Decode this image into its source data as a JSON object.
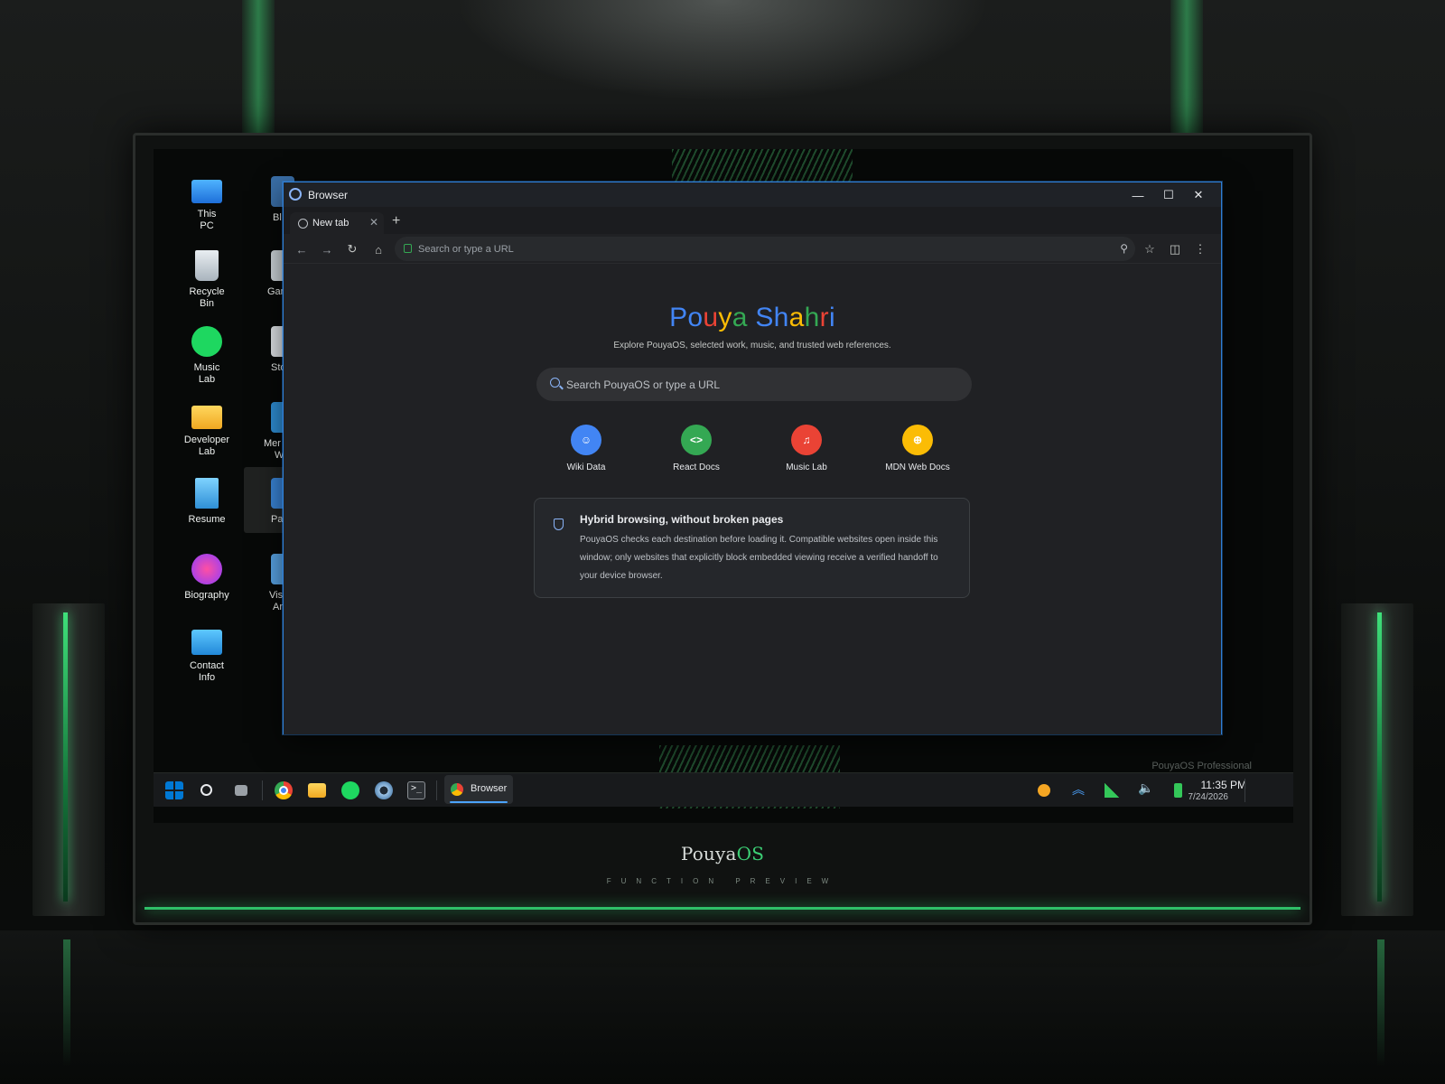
{
  "desktop": {
    "icons": [
      {
        "label_line1": "This",
        "label_line2": "PC"
      },
      {
        "label_line1": "Recycle",
        "label_line2": "Bin"
      },
      {
        "label_line1": "Music",
        "label_line2": "Lab"
      },
      {
        "label_line1": "Developer",
        "label_line2": "Lab"
      },
      {
        "label_line1": "Resume",
        "label_line2": ""
      },
      {
        "label_line1": "Biography",
        "label_line2": ""
      },
      {
        "label_line1": "Contact",
        "label_line2": "Info"
      }
    ],
    "partial_icons": [
      {
        "label_line1": "Bl",
        "label_line2": ""
      },
      {
        "label_line1": "Gar",
        "label_line2": ""
      },
      {
        "label_line1": "Sto",
        "label_line2": ""
      },
      {
        "label_line1": "Mer",
        "label_line2": "W"
      },
      {
        "label_line1": "Pa",
        "label_line2": ""
      },
      {
        "label_line1": "Vis",
        "label_line2": "Ar"
      }
    ],
    "watermark": "PouyaOS Professional"
  },
  "window": {
    "title": "Browser",
    "controls": {
      "minimize": "—",
      "maximize": "☐",
      "close": "✕"
    }
  },
  "tabs": [
    {
      "title": "New tab",
      "close": "✕"
    }
  ],
  "new_tab_label": "+",
  "toolbar": {
    "back": "←",
    "forward": "→",
    "reload": "↻",
    "home": "⌂",
    "omnibox_placeholder": "Search or type a URL",
    "search_glyph": "⚲",
    "bookmark": "☆",
    "sidepanel": "◫",
    "menu": "⋮"
  },
  "page": {
    "logo_letters": [
      {
        "ch": "P",
        "color": "#4285f4"
      },
      {
        "ch": "o",
        "color": "#4285f4"
      },
      {
        "ch": "u",
        "color": "#ea4335"
      },
      {
        "ch": "y",
        "color": "#fbbc05"
      },
      {
        "ch": "a",
        "color": "#34a853"
      },
      {
        "ch": " ",
        "color": "#ffffff"
      },
      {
        "ch": "S",
        "color": "#4285f4"
      },
      {
        "ch": "h",
        "color": "#4285f4"
      },
      {
        "ch": "a",
        "color": "#fbbc05"
      },
      {
        "ch": "h",
        "color": "#34a853"
      },
      {
        "ch": "r",
        "color": "#ea4335"
      },
      {
        "ch": "i",
        "color": "#4285f4"
      }
    ],
    "tagline": "Explore PouyaOS, selected work, music, and trusted web references.",
    "search_placeholder": "Search PouyaOS or type a URL",
    "shortcuts": [
      {
        "label": "Wiki Data",
        "glyph": "☺",
        "color": "#4285f4"
      },
      {
        "label": "React Docs",
        "glyph": "<>",
        "color": "#34a853"
      },
      {
        "label": "Music Lab",
        "glyph": "♫",
        "color": "#ea4335"
      },
      {
        "label": "MDN Web Docs",
        "glyph": "⊕",
        "color": "#fbbc05"
      }
    ],
    "info": {
      "title": "Hybrid browsing, without broken pages",
      "body": "PouyaOS checks each destination before loading it. Compatible websites open inside this window; only websites that explicitly block embedded viewing receive a verified handoff to your device browser."
    }
  },
  "taskbar": {
    "apps": [
      "start-icon",
      "search-icon",
      "task-view-icon",
      "chrome-icon",
      "file-explorer-icon",
      "spotify-icon",
      "settings-icon",
      "terminal-icon"
    ],
    "running": {
      "label": "Browser"
    },
    "clock": {
      "time": "11:35 PM",
      "date": "7/24/2026"
    }
  },
  "branding": {
    "name_prefix": "Pouya",
    "name_suffix": "OS",
    "subtitle": "FUNCTION PREVIEW"
  }
}
